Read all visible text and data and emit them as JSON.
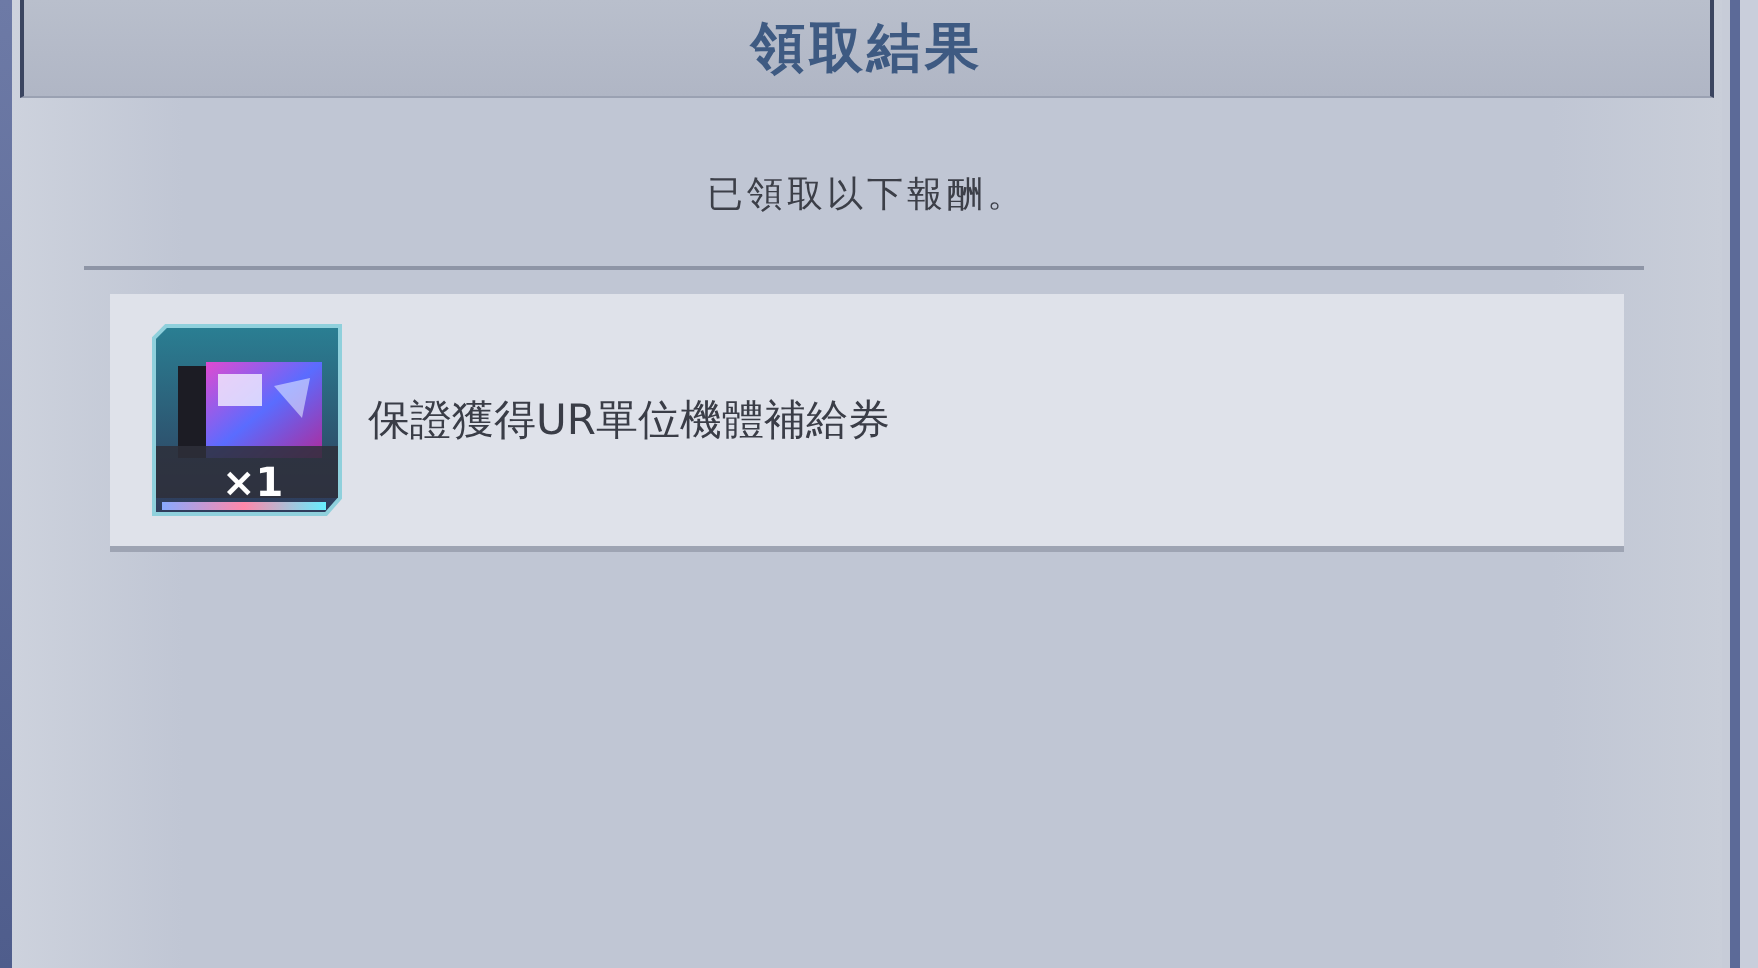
{
  "dialog": {
    "title": "領取結果",
    "message": "已領取以下報酬。"
  },
  "rewards": [
    {
      "kind": "picture",
      "name": "保證獲得UR單位機體補給券",
      "quantity": "×1"
    }
  ]
}
